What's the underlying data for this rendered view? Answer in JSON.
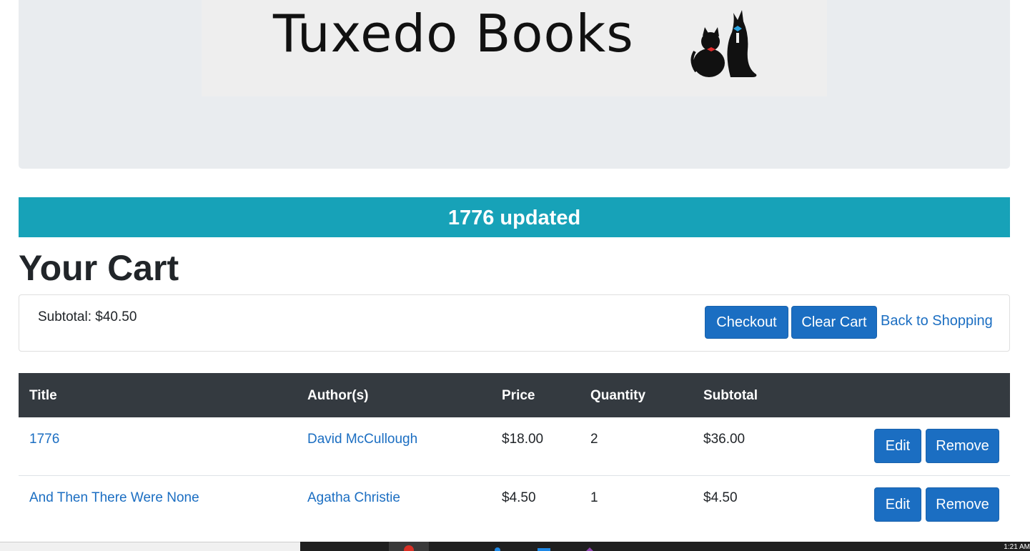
{
  "header": {
    "logo_text": "Tuxedo Books"
  },
  "alert": {
    "message": "1776 updated"
  },
  "page": {
    "title": "Your Cart"
  },
  "summary": {
    "subtotal_text": "Subtotal: $40.50",
    "checkout_label": "Checkout",
    "clear_label": "Clear Cart",
    "back_label": "Back to Shopping"
  },
  "table": {
    "headers": [
      "Title",
      "Author(s)",
      "Price",
      "Quantity",
      "Subtotal"
    ],
    "rows": [
      {
        "title": "1776",
        "author": "David McCullough",
        "price": "$18.00",
        "quantity": "2",
        "subtotal": "$36.00",
        "edit_label": "Edit",
        "remove_label": "Remove"
      },
      {
        "title": "And Then There Were None",
        "author": "Agatha Christie",
        "price": "$4.50",
        "quantity": "1",
        "subtotal": "$4.50",
        "edit_label": "Edit",
        "remove_label": "Remove"
      }
    ]
  },
  "taskbar": {
    "clock": "1:21 AM"
  },
  "colors": {
    "primary": "#1b6ec2",
    "alert_info": "#17a2b8",
    "table_header": "#343a40",
    "jumbotron": "#e9ecef"
  }
}
